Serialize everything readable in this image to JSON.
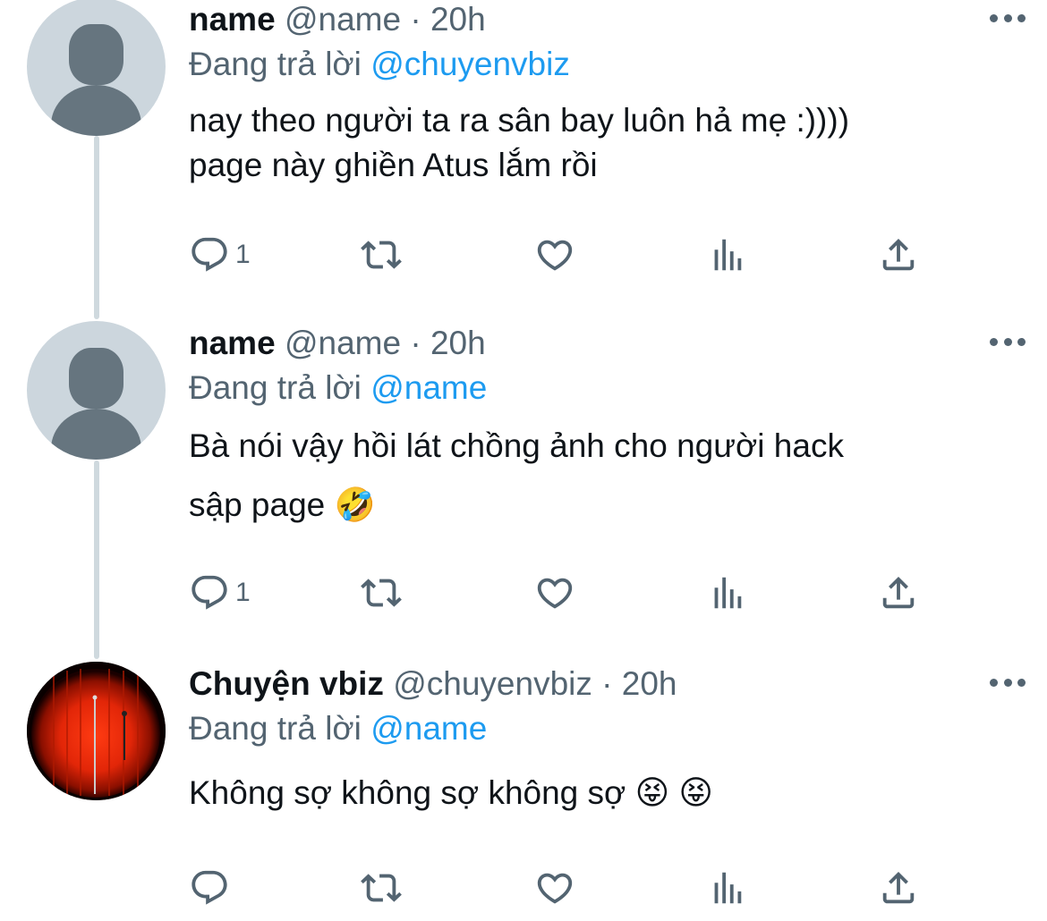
{
  "tweets": [
    {
      "display_name": "name",
      "handle": "@name",
      "separator": "·",
      "time": "20h",
      "replying_prefix": "Đang trả lời",
      "replying_to": "@chuyenvbiz",
      "text_lines": [
        "nay theo người ta ra sân bay luôn hả mẹ :))))",
        "page này ghiền Atus lắm rồi"
      ],
      "reply_count": "1",
      "avatar": "default-avatar"
    },
    {
      "display_name": "name",
      "handle": "@name",
      "separator": "·",
      "time": "20h",
      "replying_prefix": "Đang trả lời",
      "replying_to": "@name",
      "text_lines": [
        "Bà nói vậy hồi lát chồng ảnh cho người hack",
        "sập page 🤣"
      ],
      "reply_count": "1",
      "avatar": "default-avatar"
    },
    {
      "display_name": "Chuyện vbiz",
      "handle": "@chuyenvbiz",
      "separator": "·",
      "time": "20h",
      "replying_prefix": "Đang trả lời",
      "replying_to": "@name",
      "text_lines": [
        "Không sợ không sợ không sợ 😝 😝"
      ],
      "reply_count": "",
      "avatar": "stage-avatar"
    }
  ],
  "icons": [
    "reply-icon",
    "retweet-icon",
    "like-icon",
    "analytics-icon",
    "share-icon",
    "more-icon"
  ],
  "colors": {
    "mention": "#1d9bf0",
    "secondary_text": "#536471",
    "primary_text": "#0f1419",
    "thread_line": "#cfd9de"
  }
}
